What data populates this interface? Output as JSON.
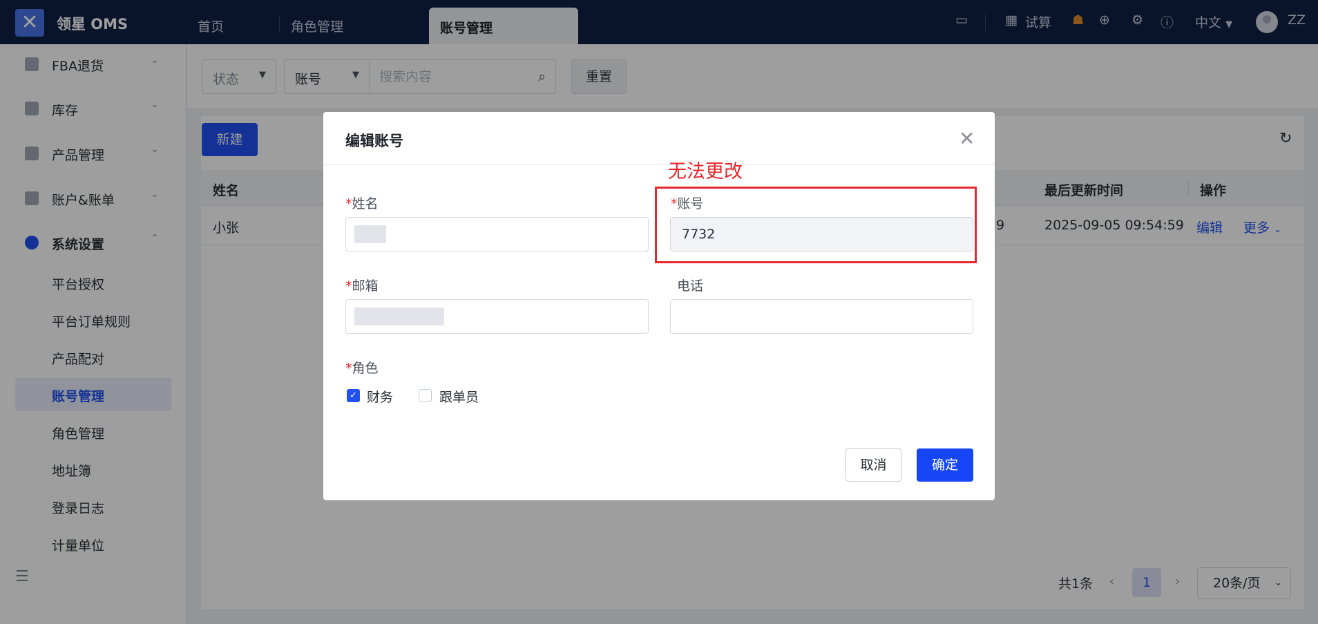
{
  "topbar": {
    "brand": "领星 OMS",
    "tabs": [
      "首页",
      "角色管理",
      "账号管理"
    ],
    "trial_label": "试算",
    "language": "中文",
    "user": "ZZ"
  },
  "sidebar": {
    "groups": [
      {
        "label": "FBA退货",
        "icon": "return-icon"
      },
      {
        "label": "库存",
        "icon": "warehouse-icon"
      },
      {
        "label": "产品管理",
        "icon": "product-icon"
      },
      {
        "label": "账户&账单",
        "icon": "billing-icon"
      },
      {
        "label": "系统设置",
        "icon": "settings-icon"
      }
    ],
    "sub_items": [
      "平台授权",
      "平台订单规则",
      "产品配对",
      "账号管理",
      "角色管理",
      "地址簿",
      "登录日志",
      "计量单位"
    ]
  },
  "filters": {
    "status_placeholder": "状态",
    "account_select": "账号",
    "search_placeholder": "搜索内容",
    "reset_label": "重置"
  },
  "toolbar": {
    "new_label": "新建"
  },
  "table": {
    "headers": {
      "name": "姓名",
      "updated": "最后更新时间",
      "actions": "操作"
    },
    "row": {
      "name": "小张",
      "partial": "9",
      "updated": "2025-09-05 09:54:59",
      "edit": "编辑",
      "more": "更多"
    }
  },
  "pagination": {
    "total": "共1条",
    "page": "1",
    "page_size": "20条/页"
  },
  "modal": {
    "title": "编辑账号",
    "name_label": "姓名",
    "account_label": "账号",
    "account_value": "7732",
    "email_label": "邮箱",
    "phone_label": "电话",
    "role_label": "角色",
    "roles": [
      {
        "label": "财务",
        "checked": true
      },
      {
        "label": "跟单员",
        "checked": false
      }
    ],
    "cancel_label": "取消",
    "ok_label": "确定"
  },
  "annotation": {
    "text": "无法更改",
    "color": "#e8262c"
  },
  "colors": {
    "primary": "#2151f1",
    "header_bg": "#0f1f45"
  }
}
